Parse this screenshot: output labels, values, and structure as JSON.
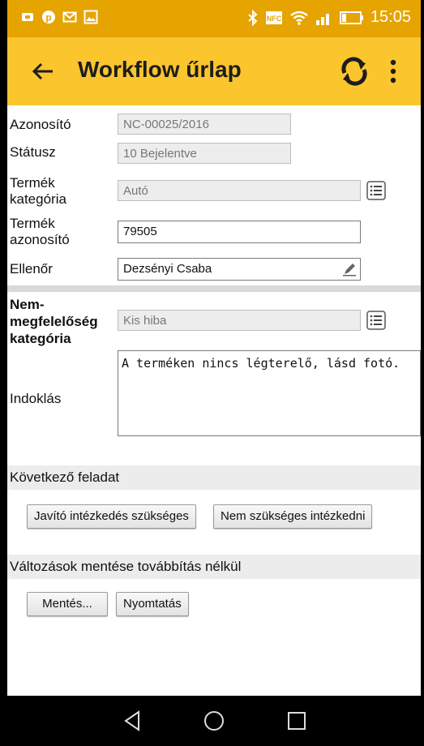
{
  "status_bar": {
    "left_icons": [
      "app-icon",
      "pinterest-icon",
      "mail-icon",
      "gallery-icon"
    ],
    "right_icons": [
      "bluetooth-icon",
      "nfc-icon",
      "wifi-icon",
      "signal-icon",
      "battery-icon"
    ],
    "time": "15:05"
  },
  "app_bar": {
    "title": "Workflow űrlap",
    "back_icon": "arrow-left-icon",
    "refresh_icon": "refresh-icon",
    "more_icon": "more-vert-icon"
  },
  "form": {
    "azonosito": {
      "label": "Azonosító",
      "value": "NC-00025/2016"
    },
    "statusz": {
      "label": "Státusz",
      "value": "10 Bejelentve"
    },
    "termek_kategoria": {
      "label_1": "Termék",
      "label_2": "kategória",
      "value": "Autó"
    },
    "termek_azonosito": {
      "label_1": "Termék",
      "label_2": "azonosító",
      "value": "79505"
    },
    "ellenor": {
      "label": "Ellenőr",
      "value": "Dezsényi Csaba"
    },
    "nem_megfeleloseg": {
      "label_1": "Nem-",
      "label_2": "megfelelőség",
      "label_3": "kategória",
      "value": "Kis hiba"
    },
    "indoklas": {
      "label": "Indoklás",
      "value": "A terméken nincs légterelő, lásd fotó."
    }
  },
  "next_task": {
    "title": "Következő feladat",
    "buttons": [
      "Javító intézkedés szükséges",
      "Nem szükséges intézkedni"
    ]
  },
  "save_section": {
    "title": "Változások mentése továbbítás nélkül",
    "buttons": [
      "Mentés...",
      "Nyomtatás"
    ]
  },
  "colors": {
    "status_bar": "#e6a400",
    "app_bar": "#fbc52d"
  }
}
